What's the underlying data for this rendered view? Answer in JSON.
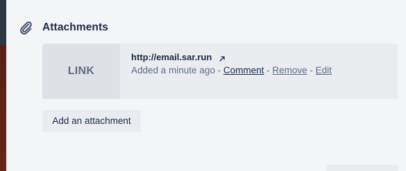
{
  "section": {
    "title": "Attachments",
    "icon": "paperclip-icon"
  },
  "attachment": {
    "thumbnail_label": "LINK",
    "title": "http://email.sar.run",
    "added": "Added a minute ago",
    "separator": " - ",
    "comment_label": "Comment",
    "remove_label": "Remove",
    "edit_label": "Edit"
  },
  "actions": {
    "add_attachment_label": "Add an attachment"
  },
  "colors": {
    "background": "#f4f5f7",
    "card": "#ebecf0",
    "thumb": "#dfe1e6",
    "text_primary": "#172b4d",
    "text_secondary": "#5e6c84"
  }
}
